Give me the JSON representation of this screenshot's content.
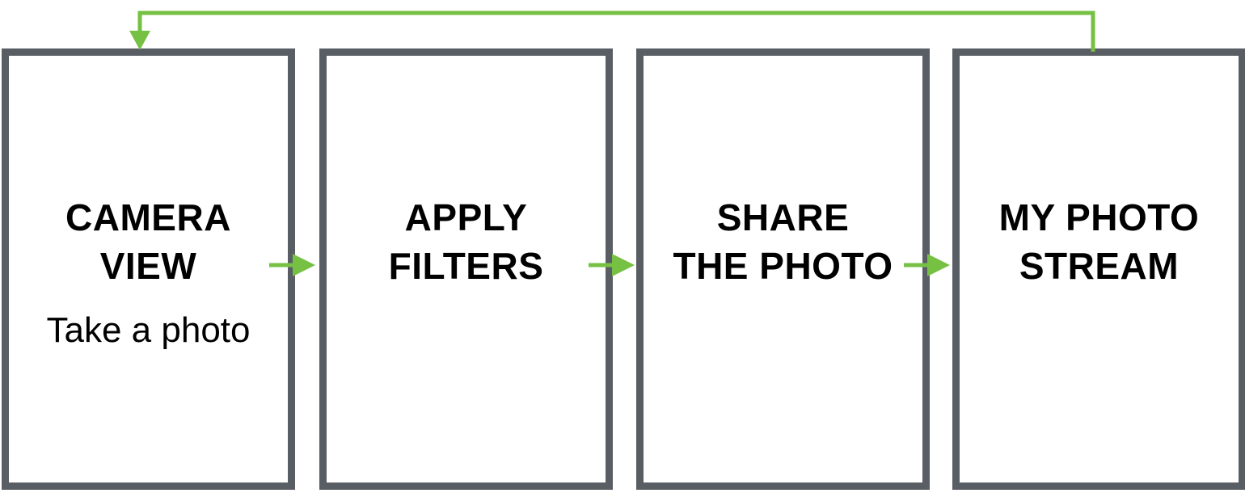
{
  "screens": [
    {
      "title_lines": [
        "CAMERA",
        "VIEW"
      ],
      "subtitle": "Take a photo"
    },
    {
      "title_lines": [
        "APPLY",
        "FILTERS"
      ],
      "subtitle": ""
    },
    {
      "title_lines": [
        "SHARE",
        "THE PHOTO"
      ],
      "subtitle": ""
    },
    {
      "title_lines": [
        "MY PHOTO",
        "STREAM"
      ],
      "subtitle": ""
    }
  ],
  "colors": {
    "frame": "#595d64",
    "arrow": "#76c043",
    "text": "#000000"
  },
  "icons": {
    "step_arrow": "arrow-right-icon",
    "loop_arrow": "loop-back-arrow-icon"
  }
}
